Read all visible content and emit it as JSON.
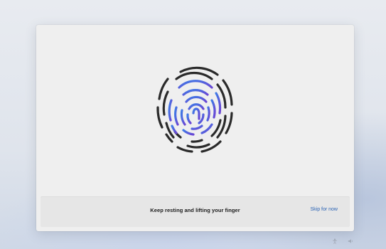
{
  "dialog": {
    "instruction": "Keep resting and lifting your finger",
    "skip_label": "Skip for now"
  },
  "fingerprint": {
    "icon": "fingerprint-icon",
    "colors": {
      "captured": "#4a6fe0",
      "captured_accent": "#6a4fd6",
      "pending": "#2a2a2a"
    }
  },
  "tray": {
    "icons": [
      "accessibility-icon",
      "volume-icon"
    ]
  }
}
